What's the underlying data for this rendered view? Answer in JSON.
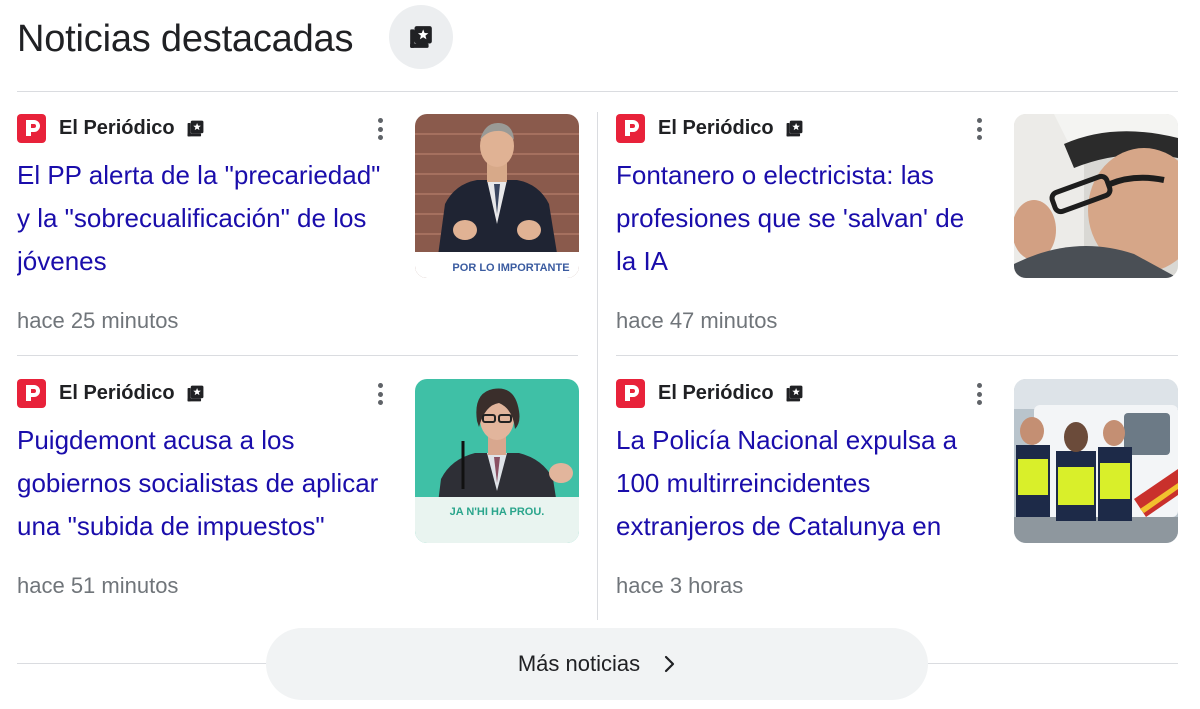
{
  "header": {
    "title": "Noticias destacadas",
    "badge_icon": "top-stories-icon"
  },
  "articles": [
    {
      "source": "El Periódico",
      "headline": "El PP alerta de la \"precariedad\" y la \"sobrecualificación\" de los jóvenes",
      "time": "hace 25 minutos",
      "image_text": "POR LO IMPORTANTE"
    },
    {
      "source": "El Periódico",
      "headline": "Fontanero o electricista: las profesiones que se 'salvan' de la IA",
      "time": "hace 47 minutos",
      "image_text": ""
    },
    {
      "source": "El Periódico",
      "headline": "Puigdemont acusa a los gobiernos socialistas de aplicar una \"subida de impuestos\"",
      "time": "hace 51 minutos",
      "image_text": "JA N'HI HA PROU."
    },
    {
      "source": "El Periódico",
      "headline": "La Policía Nacional expulsa a 100 multirreincidentes extranjeros de Catalunya en",
      "time": "hace 3 horas",
      "image_text": ""
    }
  ],
  "footer": {
    "more_label": "Más noticias",
    "more_icon": "chevron-right-icon"
  },
  "colors": {
    "link": "#1a0dab",
    "source_logo": "#e8223a",
    "meta": "#70757a"
  }
}
